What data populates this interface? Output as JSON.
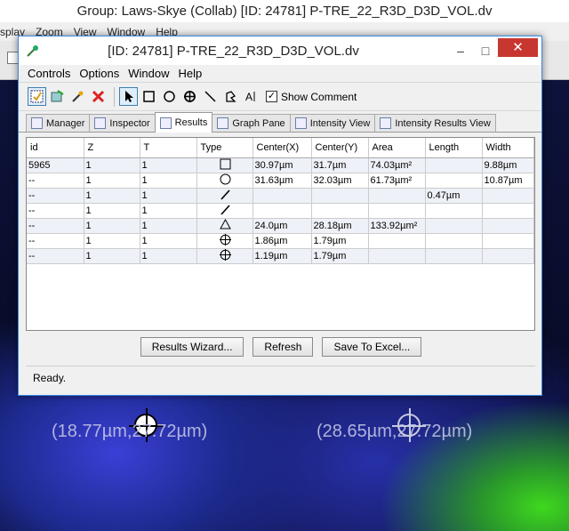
{
  "background_window": {
    "title": "Group: Laws-Skye (Collab) [ID: 24781] P-TRE_22_R3D_D3D_VOL.dv",
    "menu": [
      "splay",
      "Zoom",
      "View",
      "Window",
      "Help"
    ]
  },
  "image_labels": [
    "(18.77µm,27.72µm)",
    "(28.65µm,27.72µm)"
  ],
  "window": {
    "title": "[ID: 24781] P-TRE_22_R3D_D3D_VOL.dv",
    "minimize": "–",
    "maximize": "□",
    "close": "✕"
  },
  "menubar": [
    "Controls",
    "Options",
    "Window",
    "Help"
  ],
  "toolbar": {
    "show_comment_label": "Show Comment",
    "show_comment_checked": true
  },
  "tabs": [
    {
      "label": "Manager",
      "active": false
    },
    {
      "label": "Inspector",
      "active": false
    },
    {
      "label": "Results",
      "active": true
    },
    {
      "label": "Graph Pane",
      "active": false
    },
    {
      "label": "Intensity View",
      "active": false
    },
    {
      "label": "Intensity Results View",
      "active": false
    }
  ],
  "table": {
    "columns": [
      "id",
      "Z",
      "T",
      "Type",
      "Center(X)",
      "Center(Y)",
      "Area",
      "Length",
      "Width"
    ],
    "rows": [
      {
        "id": "5965",
        "z": "1",
        "t": "1",
        "type": "square",
        "cx": "30.97µm",
        "cy": "31.7µm",
        "area": "74.03µm²",
        "length": "",
        "width": "9.88µm"
      },
      {
        "id": "--",
        "z": "1",
        "t": "1",
        "type": "circle",
        "cx": "31.63µm",
        "cy": "32.03µm",
        "area": "61.73µm²",
        "length": "",
        "width": "10.87µm"
      },
      {
        "id": "--",
        "z": "1",
        "t": "1",
        "type": "line",
        "cx": "",
        "cy": "",
        "area": "",
        "length": "0.47µm",
        "width": ""
      },
      {
        "id": "--",
        "z": "1",
        "t": "1",
        "type": "line",
        "cx": "",
        "cy": "",
        "area": "",
        "length": "",
        "width": ""
      },
      {
        "id": "--",
        "z": "1",
        "t": "1",
        "type": "polygon",
        "cx": "24.0µm",
        "cy": "28.18µm",
        "area": "133.92µm²",
        "length": "",
        "width": ""
      },
      {
        "id": "--",
        "z": "1",
        "t": "1",
        "type": "crosshair",
        "cx": "1.86µm",
        "cy": "1.79µm",
        "area": "",
        "length": "",
        "width": ""
      },
      {
        "id": "--",
        "z": "1",
        "t": "1",
        "type": "crosshair",
        "cx": "1.19µm",
        "cy": "1.79µm",
        "area": "",
        "length": "",
        "width": ""
      }
    ]
  },
  "buttons": {
    "results_wizard": "Results Wizard...",
    "refresh": "Refresh",
    "save_to_excel": "Save To Excel..."
  },
  "status": "Ready."
}
